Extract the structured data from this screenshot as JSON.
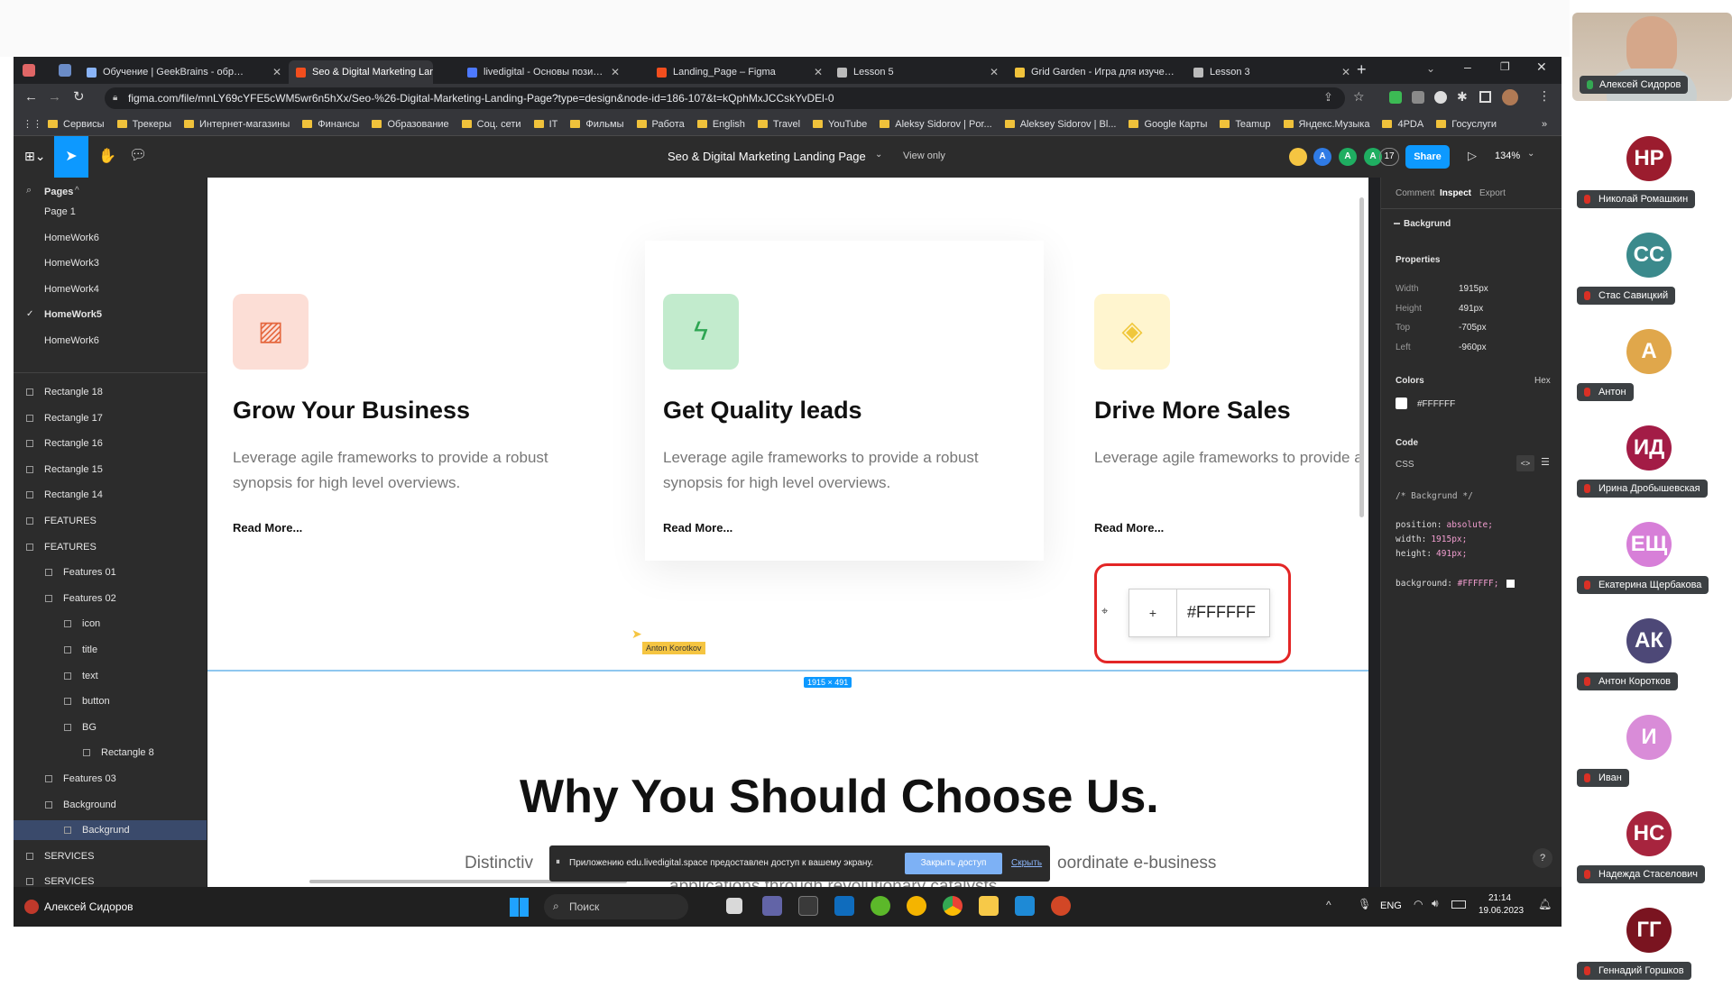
{
  "browser": {
    "tabs": [
      {
        "title": "Обучение | GeekBrains - обр…",
        "active": false
      },
      {
        "title": "Seo & Digital Marketing Landi…",
        "active": true
      },
      {
        "title": "livedigital - Основы пози…",
        "active": false
      },
      {
        "title": "Landing_Page – Figma",
        "active": false
      },
      {
        "title": "Lesson 5",
        "active": false
      },
      {
        "title": "Grid Garden - Игра для изуче…",
        "active": false
      },
      {
        "title": "Lesson 3",
        "active": false
      }
    ],
    "url": "figma.com/file/mnLY69cYFE5cWM5wr6n5hXx/Seo-%26-Digital-Marketing-Landing-Page?type=design&node-id=186-107&t=kQphMxJCCskYvDEl-0",
    "bookmarks": [
      "Сервисы",
      "Трекеры",
      "Интернет-магазины",
      "Финансы",
      "Образование",
      "Соц. сети",
      "IT",
      "Фильмы",
      "Работа",
      "English",
      "Travel",
      "YouTube",
      "Aleksy Sidorov | Por...",
      "Aleksey Sidorov | Bl...",
      "Google Карты",
      "Teamup",
      "Яндекс.Музыка",
      "4PDA",
      "Госуслуги"
    ]
  },
  "figma": {
    "file_title": "Seo & Digital Marketing Landing Page",
    "view_mode": "View only",
    "share_label": "Share",
    "zoom": "134%",
    "avatar_letters": [
      "A",
      "A",
      "A"
    ],
    "viewer_count": "17",
    "layers_panel": {
      "pages_label": "Pages",
      "pages": [
        {
          "name": "Page 1",
          "checked": false
        },
        {
          "name": "HomeWork6",
          "checked": false
        },
        {
          "name": "HomeWork3",
          "checked": false
        },
        {
          "name": "HomeWork4",
          "checked": false
        },
        {
          "name": "HomeWork5",
          "checked": true
        },
        {
          "name": "HomeWork6",
          "checked": false
        }
      ],
      "layers": [
        {
          "name": "Rectangle 18",
          "indent": 0
        },
        {
          "name": "Rectangle 17",
          "indent": 0
        },
        {
          "name": "Rectangle 16",
          "indent": 0
        },
        {
          "name": "Rectangle 15",
          "indent": 0
        },
        {
          "name": "Rectangle 14",
          "indent": 0
        },
        {
          "name": "FEATURES",
          "indent": 0
        },
        {
          "name": "FEATURES",
          "indent": 0
        },
        {
          "name": "Features 01",
          "indent": 1
        },
        {
          "name": "Features 02",
          "indent": 1
        },
        {
          "name": "icon",
          "indent": 2
        },
        {
          "name": "title",
          "indent": 2
        },
        {
          "name": "text",
          "indent": 2
        },
        {
          "name": "button",
          "indent": 2
        },
        {
          "name": "BG",
          "indent": 2
        },
        {
          "name": "Rectangle 8",
          "indent": 3
        },
        {
          "name": "Features 03",
          "indent": 1
        },
        {
          "name": "Background",
          "indent": 1
        },
        {
          "name": "Backgrund",
          "indent": 2,
          "selected": true
        },
        {
          "name": "SERVICES",
          "indent": 0
        },
        {
          "name": "SERVICES",
          "indent": 0
        }
      ]
    },
    "canvas": {
      "cards": [
        {
          "title": "Grow Your Business",
          "text": "Leverage agile frameworks to provide a robust synopsis for high level overviews.",
          "link": "Read More...",
          "icon_name": "chart-icon",
          "icon_bg": "#fcded6",
          "icon_color": "#e5683f"
        },
        {
          "title": "Get Quality leads",
          "text": "Leverage agile frameworks to provide a robust synopsis for high level overviews.",
          "link": "Read More...",
          "icon_name": "lightning-icon",
          "icon_bg": "#c2ebcd",
          "icon_color": "#2ea653"
        },
        {
          "title": "Drive More Sales",
          "text": "Leverage agile frameworks to provide a robust synopsis for high level overviews.",
          "link": "Read More...",
          "icon_name": "tag-icon",
          "icon_bg": "#fff5cf",
          "icon_color": "#f0c73c"
        }
      ],
      "cursor_label": "Anton Korotkov",
      "size_badge": "1915 × 491",
      "color_chip": "#FFFFFF",
      "heading": "Why You Should Choose Us.",
      "subtext_left": "Distinctiv",
      "subtext_right": "oordinate e-business",
      "subtext_bottom": "applications through revolutionary catalysts",
      "share_notice": {
        "text": "Приложению edu.livedigital.space предоставлен доступ к вашему экрану.",
        "stop": "Закрыть доступ",
        "hide": "Скрыть"
      }
    },
    "inspect_panel": {
      "tabs": [
        "Comment",
        "Inspect",
        "Export"
      ],
      "active_tab": "Inspect",
      "layer_name": "Backgrund",
      "properties_label": "Properties",
      "properties": [
        {
          "label": "Width",
          "value": "1915px"
        },
        {
          "label": "Height",
          "value": "491px"
        },
        {
          "label": "Top",
          "value": "-705px"
        },
        {
          "label": "Left",
          "value": "-960px"
        }
      ],
      "colors_label": "Colors",
      "color_format": "Hex",
      "color_value": "#FFFFFF",
      "code_label": "Code",
      "code_lang": "CSS",
      "code_comment": "/* Backgrund */",
      "code_lines": [
        {
          "prop": "position:",
          "val": "absolute;"
        },
        {
          "prop": "width:",
          "val": "1915px;"
        },
        {
          "prop": "height:",
          "val": "491px;"
        }
      ],
      "code_bg_prop": "background:",
      "code_bg_val": "#FFFFFF;"
    }
  },
  "taskbar": {
    "user": "Алексей Сидоров",
    "search": "Поиск",
    "lang": "ENG",
    "time": "21:14",
    "date": "19.06.2023"
  },
  "video": {
    "self_name": "Алексей Сидоров",
    "participants": [
      {
        "initials": "НР",
        "name": "Николай Ромашкин",
        "color": "#9b1c2e"
      },
      {
        "initials": "СС",
        "name": "Стас Савицкий",
        "color": "#3b8a8c"
      },
      {
        "initials": "А",
        "name": "Антон",
        "color": "#e0a74b"
      },
      {
        "initials": "ИД",
        "name": "Ирина Дробышевская",
        "color": "#a31c46"
      },
      {
        "initials": "ЕЩ",
        "name": "Екатерина Щербакова",
        "color": "#d77fd8"
      },
      {
        "initials": "АК",
        "name": "Антон Коротков",
        "color": "#4d4877"
      },
      {
        "initials": "И",
        "name": "Иван",
        "color": "#d98cd8"
      },
      {
        "initials": "НС",
        "name": "Надежда Стаселович",
        "color": "#a7243e"
      },
      {
        "initials": "ГГ",
        "name": "Геннадий Горшков",
        "color": "#7a1420"
      }
    ]
  }
}
